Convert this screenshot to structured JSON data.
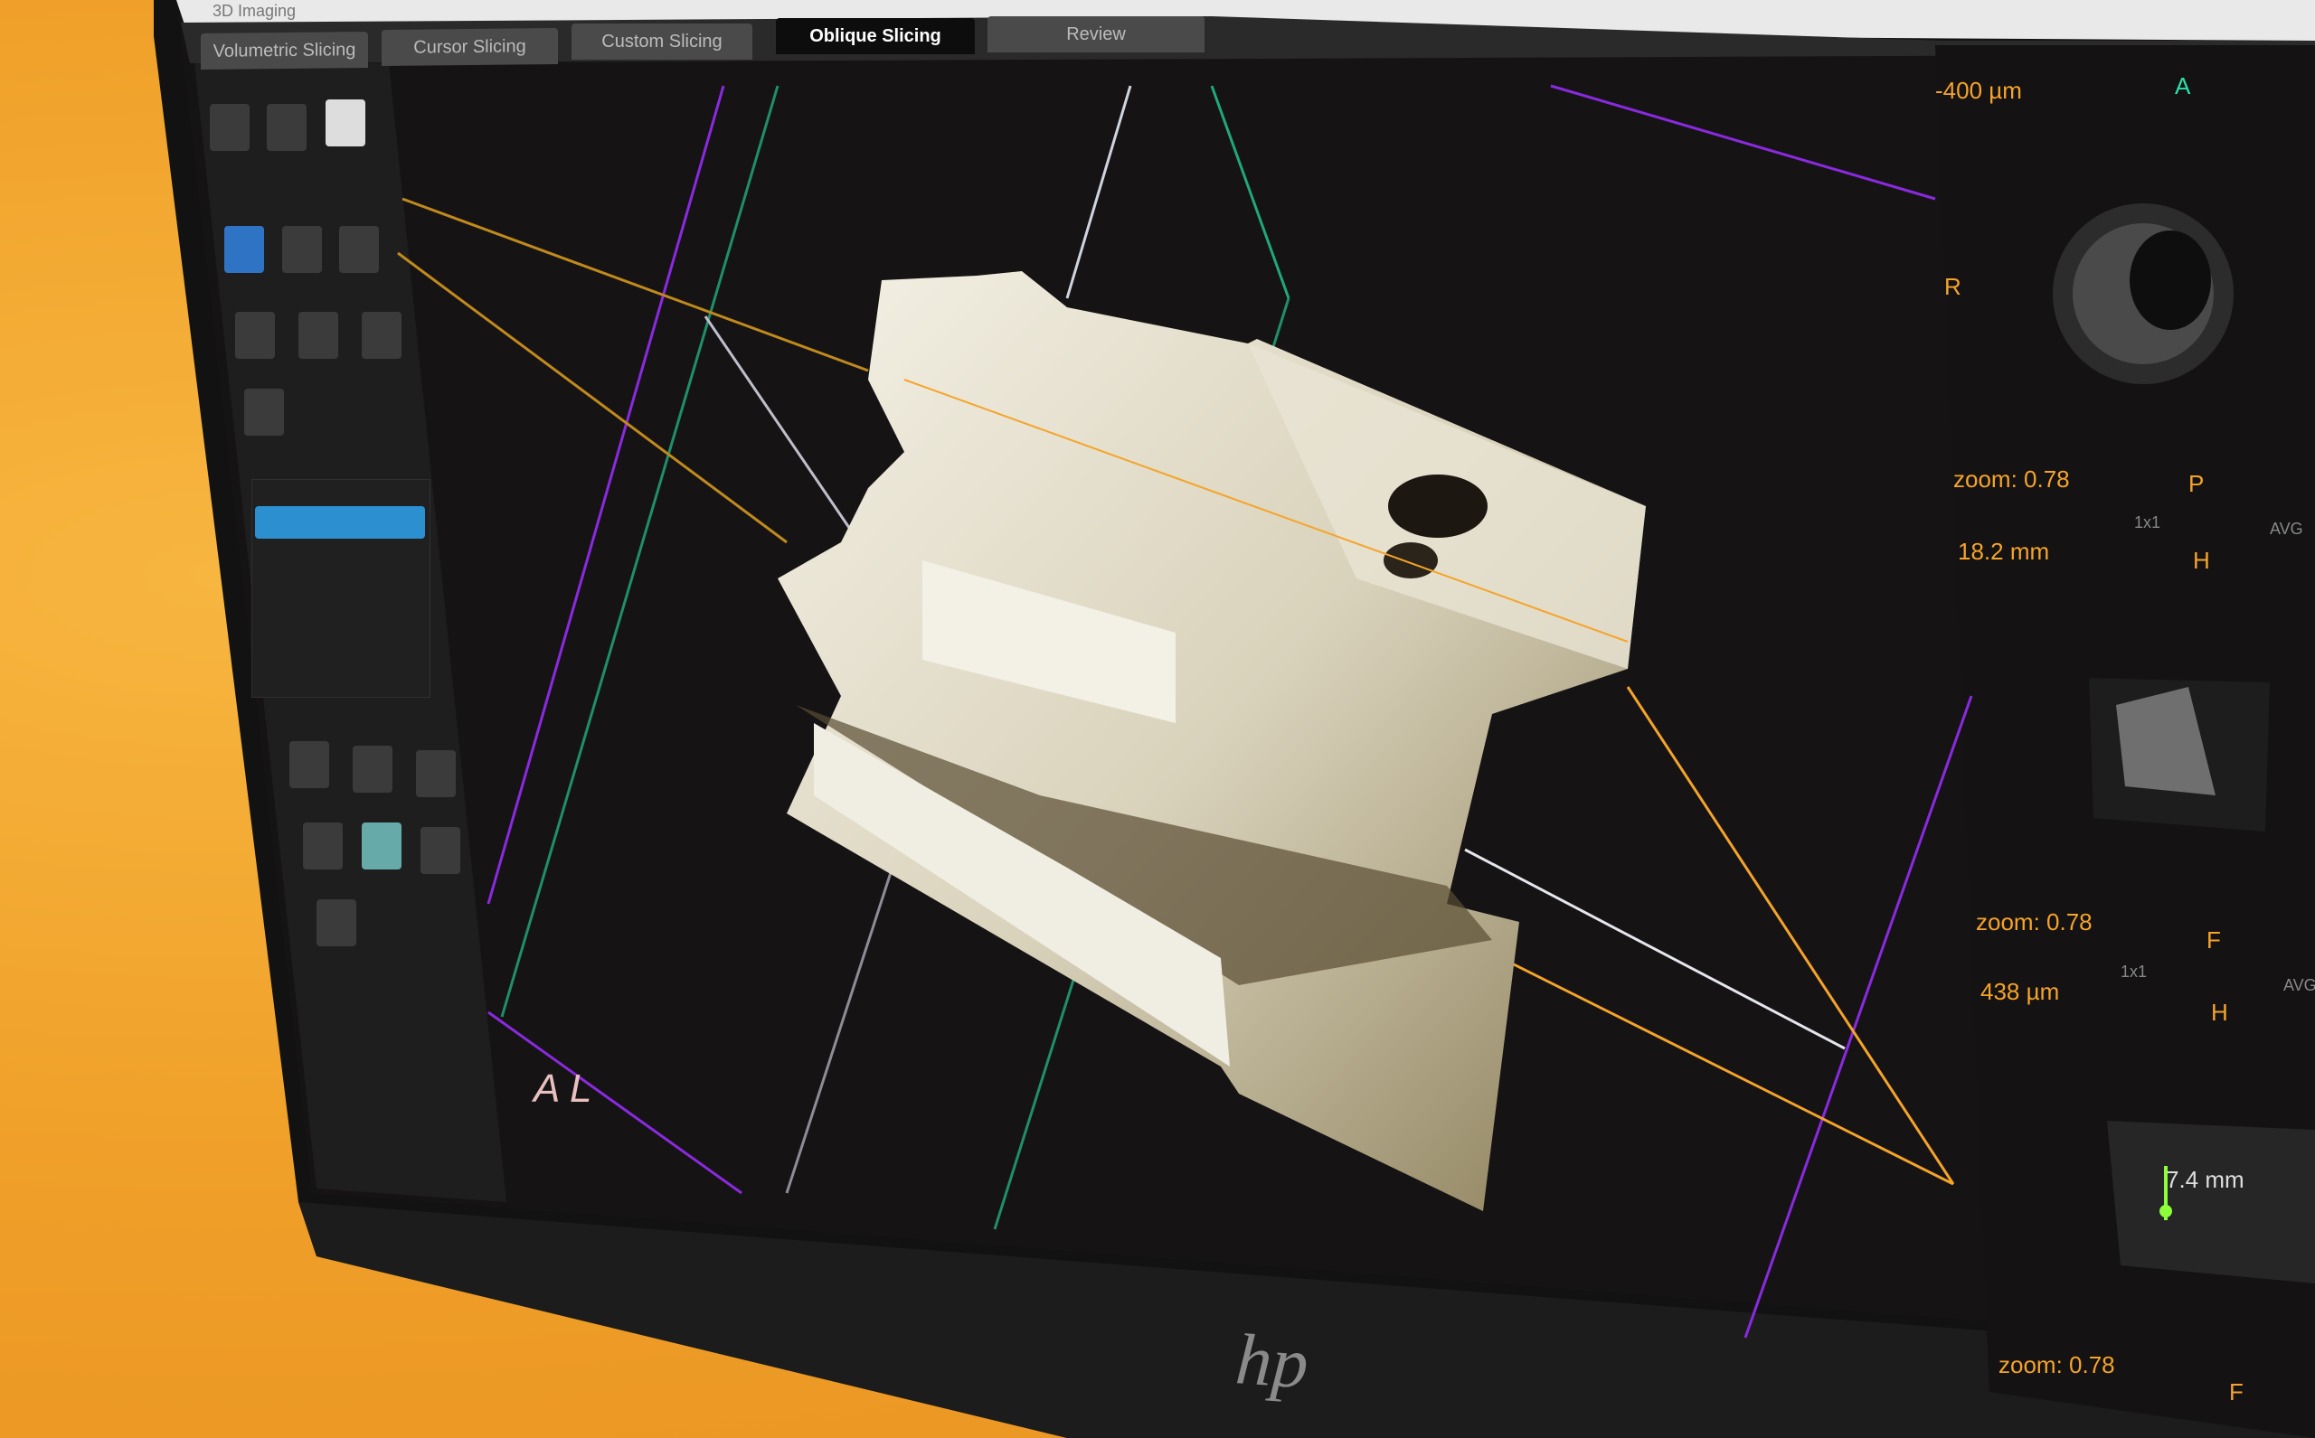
{
  "app": {
    "title": "3D Imaging"
  },
  "tabs": [
    {
      "label": "Volumetric Slicing"
    },
    {
      "label": "Cursor Slicing"
    },
    {
      "label": "Custom Slicing"
    },
    {
      "label": "Oblique Slicing"
    },
    {
      "label": "Review"
    }
  ],
  "right_panel": {
    "top": {
      "value": "-400 µm",
      "orient_r": "R",
      "orient_a": "A"
    },
    "mid": {
      "zoom": "zoom: 0.78",
      "value": "18.2 mm",
      "orient_p": "P",
      "orient_h": "H",
      "ratio": "1x1",
      "avg": "AVG"
    },
    "low": {
      "zoom": "zoom: 0.78",
      "value": "438 µm",
      "orient_f": "F",
      "orient_h": "H",
      "ratio": "1x1",
      "avg": "AVG"
    },
    "measure": "7.4 mm",
    "bottom": {
      "zoom": "zoom: 0.78",
      "orient_f": "F"
    }
  },
  "viewport": {
    "corner": "A L"
  },
  "brand": "hp"
}
